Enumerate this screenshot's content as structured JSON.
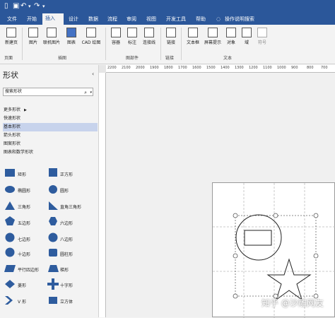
{
  "quick_access": {
    "file_icon": "file-icon",
    "save_icon": "save-icon",
    "undo_icon": "undo-icon",
    "redo_icon": "redo-icon",
    "more_icon": "dropdown-icon"
  },
  "tabs": [
    {
      "label": "文件"
    },
    {
      "label": "开始"
    },
    {
      "label": "插入"
    },
    {
      "label": "设计"
    },
    {
      "label": "数据"
    },
    {
      "label": "流程"
    },
    {
      "label": "审阅"
    },
    {
      "label": "视图"
    },
    {
      "label": "开发工具"
    },
    {
      "label": "帮助"
    },
    {
      "label": "操作说明搜索"
    }
  ],
  "ribbon": {
    "new_page": "新建页",
    "picture": "图片",
    "online_picture": "联机图片",
    "chart": "图表",
    "cad_drawing": "CAD 绘图",
    "container": "容器",
    "callout": "标注",
    "connector": "连接线",
    "link": "链接",
    "textbox": "文本框",
    "screentip": "屏幕提示",
    "object": "对象",
    "field": "域",
    "symbol": "符号",
    "group_page": "页面",
    "group_illustrations": "插图",
    "group_parts": "图部件",
    "group_links": "链接",
    "group_text": "文本"
  },
  "shapes_panel": {
    "title": "形状",
    "search_value": "搜索形状",
    "more_shapes": "更多形状",
    "categories": [
      "快速形状",
      "基本形状",
      "箭头形状",
      "图案形状",
      "图表和数学形状"
    ],
    "shapes": [
      {
        "label": "矩形",
        "icon": "rectangle-icon"
      },
      {
        "label": "正方形",
        "icon": "square-icon"
      },
      {
        "label": "椭圆形",
        "icon": "ellipse-icon"
      },
      {
        "label": "圆形",
        "icon": "circle-icon"
      },
      {
        "label": "三角形",
        "icon": "triangle-icon"
      },
      {
        "label": "直角三角形",
        "icon": "right-triangle-icon"
      },
      {
        "label": "五边形",
        "icon": "pentagon-icon"
      },
      {
        "label": "六边形",
        "icon": "hexagon-icon"
      },
      {
        "label": "七边形",
        "icon": "heptagon-icon"
      },
      {
        "label": "八边形",
        "icon": "octagon-icon"
      },
      {
        "label": "十边形",
        "icon": "decagon-icon"
      },
      {
        "label": "圆柱形",
        "icon": "cylinder-icon"
      },
      {
        "label": "平行四边形",
        "icon": "parallelogram-icon"
      },
      {
        "label": "梯形",
        "icon": "trapezoid-icon"
      },
      {
        "label": "菱形",
        "icon": "diamond-icon"
      },
      {
        "label": "十字形",
        "icon": "cross-icon"
      },
      {
        "label": "V 形",
        "icon": "chevron-icon"
      },
      {
        "label": "立方体",
        "icon": "cube-icon"
      }
    ]
  },
  "ruler": {
    "ticks": [
      "2200",
      "2100",
      "2000",
      "1900",
      "1800",
      "1700",
      "1600",
      "1500",
      "1400",
      "1300",
      "1200",
      "1100",
      "1000",
      "900",
      "800",
      "700"
    ]
  },
  "watermark": "知乎 @沙雕网友",
  "colors": {
    "titlebar": "#2b579a",
    "shape_fill": "#2e5c9e",
    "selected_category": "#c7d3ec"
  }
}
